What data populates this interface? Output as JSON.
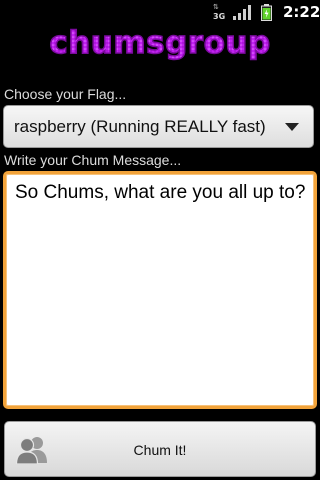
{
  "status_bar": {
    "time": "2:22",
    "network_type": "3G",
    "icons": [
      "data-activity-icon",
      "signal-icon",
      "battery-icon"
    ],
    "battery_color": "#5fd22a"
  },
  "app": {
    "logo_text": "chumsgroup",
    "logo_color": "#c21ff2"
  },
  "form": {
    "flag_label": "Choose your Flag...",
    "flag_value": "raspberry (Running REALLY fast)",
    "message_label": "Write your Chum Message...",
    "message_value": "So Chums, what are you all up to?",
    "focus_color": "#f2a33a"
  },
  "action": {
    "button_label": "Chum It!",
    "button_icon": "people-icon"
  }
}
